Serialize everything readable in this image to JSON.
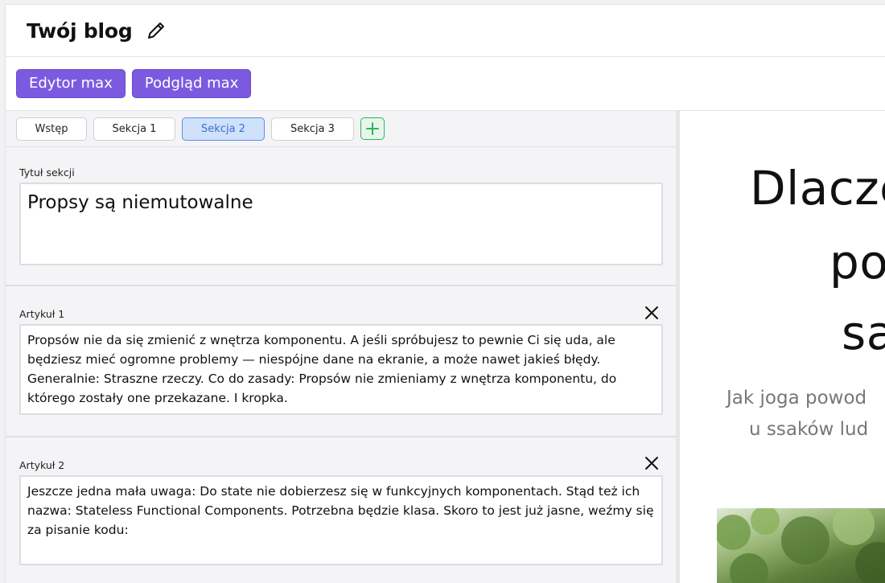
{
  "header": {
    "title": "Twój blog",
    "edit_icon": "pencil-icon"
  },
  "modes": {
    "editor_max": "Edytor max",
    "preview_max": "Podgląd max"
  },
  "tabs": [
    {
      "label": "Wstęp",
      "active": false
    },
    {
      "label": "Sekcja 1",
      "active": false
    },
    {
      "label": "Sekcja 2",
      "active": true
    },
    {
      "label": "Sekcja 3",
      "active": false
    }
  ],
  "add_tab_icon": "plus-icon",
  "section": {
    "title_label": "Tytuł sekcji",
    "title_value": "Propsy są niemutowalne"
  },
  "articles": [
    {
      "label": "Artykuł 1",
      "text": "Propsów nie da się zmienić z wnętrza komponentu. A jeśli spróbujesz to pewnie Ci się uda, ale będziesz mieć ogromne problemy — niespójne dane na ekranie, a może nawet jakieś błędy. Generalnie: Straszne rzeczy. Co do zasady: Propsów nie zmieniamy z wnętrza komponentu, do którego zostały one przekazane. I kropka."
    },
    {
      "label": "Artykuł 2",
      "text": "Jeszcze jedna mała uwaga: Do state nie dobierzesz się w funkcyjnych komponentach. Stąd też ich nazwa: Stateless Functional Components. Potrzebna będzie klasa. Skoro to jest już jasne, weźmy się za pisanie kodu:"
    }
  ],
  "preview": {
    "heading_lines": [
      "Dlacze",
      "po",
      "sa"
    ],
    "subtitle_lines": [
      "Jak joga powod",
      "u ssaków lud"
    ]
  },
  "colors": {
    "accent_purple": "#7c5ae0",
    "active_tab_blue": "#cfe1fb",
    "add_green": "#2fb35a"
  }
}
